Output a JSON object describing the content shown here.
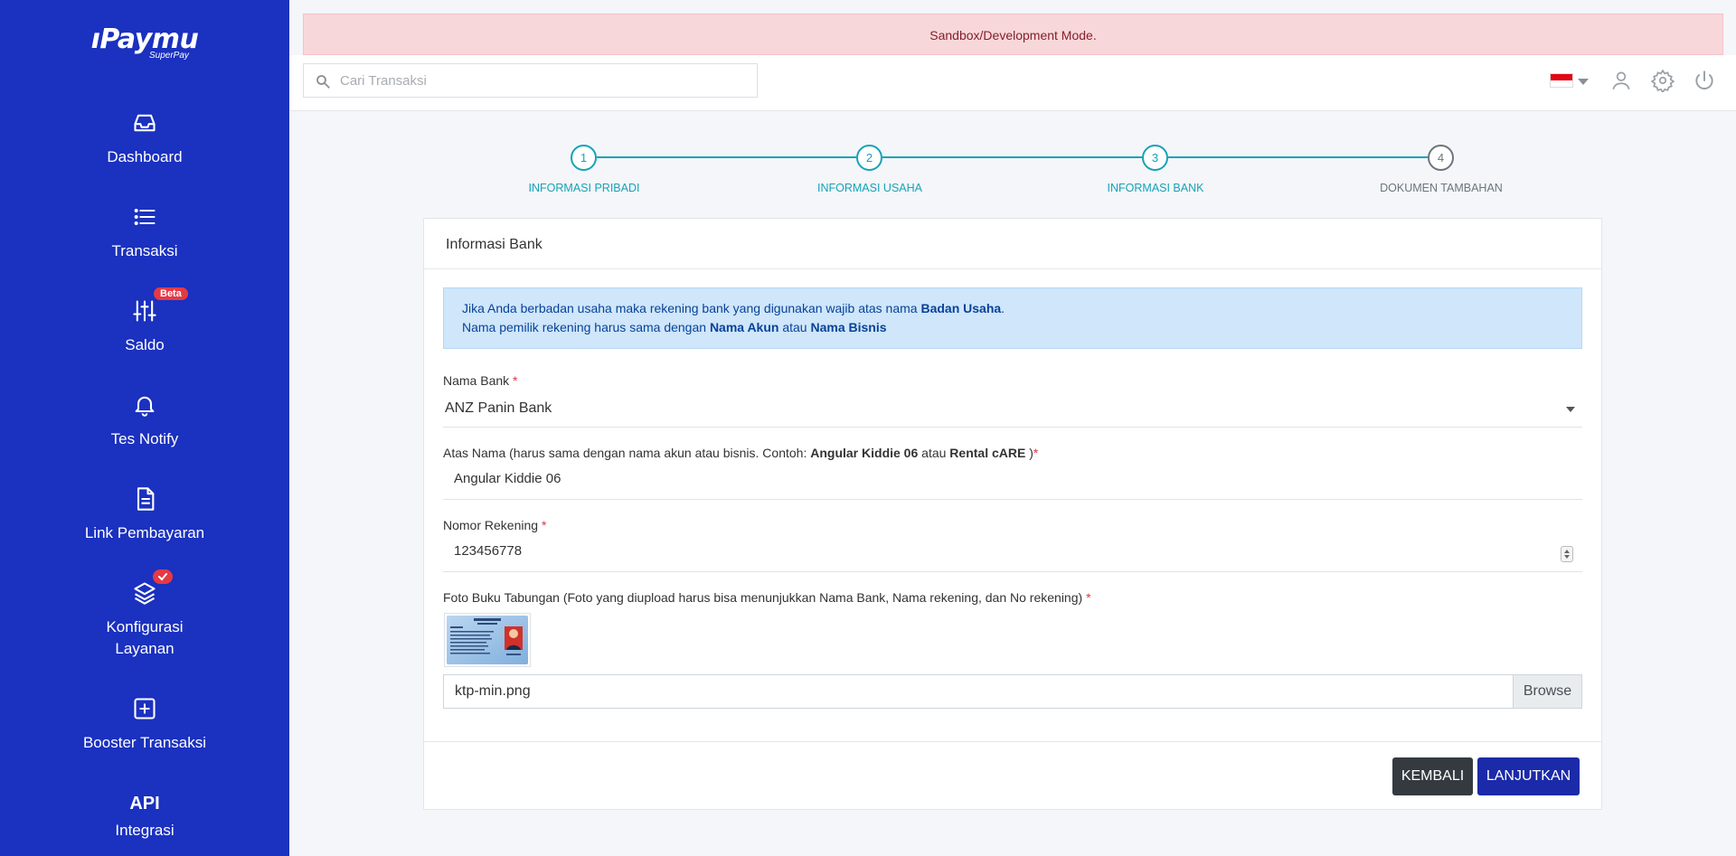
{
  "sidebar": {
    "logo": {
      "brand": "ıPaymu",
      "sub": "SuperPay"
    },
    "items": [
      {
        "label": "Dashboard",
        "icon": "inbox-icon"
      },
      {
        "label": "Transaksi",
        "icon": "list-icon"
      },
      {
        "label": "Saldo",
        "icon": "sliders-icon",
        "badge": "Beta"
      },
      {
        "label": "Tes Notify",
        "icon": "bell-icon"
      },
      {
        "label": "Link Pembayaran",
        "icon": "document-icon"
      },
      {
        "label": "Konfigurasi",
        "label2": "Layanan",
        "icon": "layers-icon",
        "badge_icon": "check-icon"
      },
      {
        "label": "Booster Transaksi",
        "icon": "plus-square-icon"
      },
      {
        "label_big": "API",
        "label": "Integrasi"
      }
    ],
    "colors": {
      "bg": "#1b31bf"
    }
  },
  "alert": {
    "text": "Sandbox/Development Mode."
  },
  "topbar": {
    "search_placeholder": "Cari Transaksi",
    "icons": [
      "flag-icon",
      "user-icon",
      "gear-icon",
      "power-icon"
    ]
  },
  "stepper": {
    "steps": [
      {
        "num": "1",
        "label": "INFORMASI PRIBADI",
        "active": true
      },
      {
        "num": "2",
        "label": "INFORMASI USAHA",
        "active": true
      },
      {
        "num": "3",
        "label": "INFORMASI BANK",
        "active": true
      },
      {
        "num": "4",
        "label": "DOKUMEN TAMBAHAN",
        "active": false
      }
    ],
    "colors": {
      "active": "#17a2b8",
      "inactive": "#6c757d"
    }
  },
  "card": {
    "title": "Informasi Bank",
    "info": {
      "line1_pre": "Jika Anda berbadan usaha maka rekening bank yang digunakan wajib atas nama ",
      "line1_bold": "Badan Usaha",
      "line1_post": ".",
      "line2_pre": "Nama pemilik rekening harus sama dengan ",
      "line2_bold1": "Nama Akun",
      "line2_mid": " atau ",
      "line2_bold2": "Nama Bisnis"
    },
    "bank": {
      "label": "Nama Bank",
      "req": "*",
      "value": "ANZ Panin Bank"
    },
    "holder": {
      "label_pre": "Atas Nama (harus sama dengan nama akun atau bisnis. Contoh: ",
      "label_bold1": "Angular Kiddie 06",
      "label_mid": " atau ",
      "label_bold2": "Rental cARE",
      "label_post": " )",
      "req": "*",
      "value": "Angular Kiddie 06"
    },
    "account": {
      "label": "Nomor Rekening",
      "req": "*",
      "value": "123456778"
    },
    "passbook": {
      "label": "Foto Buku Tabungan (Foto yang diupload harus bisa menunjukkan Nama Bank, Nama rekening, dan No rekening)",
      "req": "*",
      "file_name": "ktp-min.png",
      "browse": "Browse"
    },
    "buttons": {
      "back": "KEMBALI",
      "next": "LANJUTKAN"
    }
  }
}
